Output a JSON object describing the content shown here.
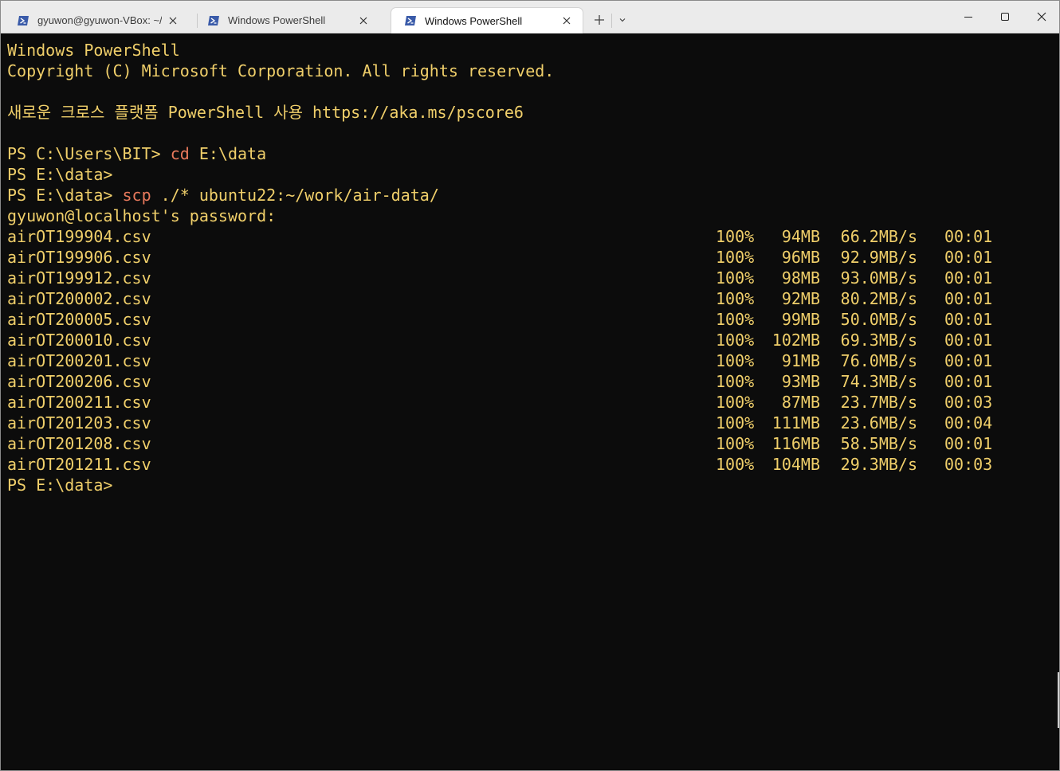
{
  "tabs": [
    {
      "title": "gyuwon@gyuwon-VBox: ~/wc",
      "active": false
    },
    {
      "title": "Windows PowerShell",
      "active": false
    },
    {
      "title": "Windows PowerShell",
      "active": true
    }
  ],
  "window_controls": {
    "minimize": "minimize",
    "maximize": "maximize",
    "close": "close"
  },
  "colors": {
    "terminal_bg": "#0c0c0c",
    "text": "#f0cf6a",
    "command": "#e8795c",
    "tab_icon": "#3a5ba9"
  },
  "terminal": {
    "header_line1": "Windows PowerShell",
    "header_line2": "Copyright (C) Microsoft Corporation. All rights reserved.",
    "header_line3": "새로운 크로스 플랫폼 PowerShell 사용 https://aka.ms/pscore6",
    "prompt1": "PS C:\\Users\\BIT> ",
    "command1": "cd",
    "command1_args": " E:\\data",
    "prompt2": "PS E:\\data>",
    "prompt3": "PS E:\\data> ",
    "command3": "scp",
    "command3_args": " ./* ubuntu22:~/work/air-data/",
    "password_prompt": "gyuwon@localhost's password:",
    "transfers": [
      {
        "file": "airOT199904.csv",
        "percent": "100%",
        "size": "94MB",
        "rate": "66.2MB/s",
        "time": "00:01"
      },
      {
        "file": "airOT199906.csv",
        "percent": "100%",
        "size": "96MB",
        "rate": "92.9MB/s",
        "time": "00:01"
      },
      {
        "file": "airOT199912.csv",
        "percent": "100%",
        "size": "98MB",
        "rate": "93.0MB/s",
        "time": "00:01"
      },
      {
        "file": "airOT200002.csv",
        "percent": "100%",
        "size": "92MB",
        "rate": "80.2MB/s",
        "time": "00:01"
      },
      {
        "file": "airOT200005.csv",
        "percent": "100%",
        "size": "99MB",
        "rate": "50.0MB/s",
        "time": "00:01"
      },
      {
        "file": "airOT200010.csv",
        "percent": "100%",
        "size": "102MB",
        "rate": "69.3MB/s",
        "time": "00:01"
      },
      {
        "file": "airOT200201.csv",
        "percent": "100%",
        "size": "91MB",
        "rate": "76.0MB/s",
        "time": "00:01"
      },
      {
        "file": "airOT200206.csv",
        "percent": "100%",
        "size": "93MB",
        "rate": "74.3MB/s",
        "time": "00:01"
      },
      {
        "file": "airOT200211.csv",
        "percent": "100%",
        "size": "87MB",
        "rate": "23.7MB/s",
        "time": "00:03"
      },
      {
        "file": "airOT201203.csv",
        "percent": "100%",
        "size": "111MB",
        "rate": "23.6MB/s",
        "time": "00:04"
      },
      {
        "file": "airOT201208.csv",
        "percent": "100%",
        "size": "116MB",
        "rate": "58.5MB/s",
        "time": "00:01"
      },
      {
        "file": "airOT201211.csv",
        "percent": "100%",
        "size": "104MB",
        "rate": "29.3MB/s",
        "time": "00:03"
      }
    ],
    "final_prompt": "PS E:\\data>"
  }
}
